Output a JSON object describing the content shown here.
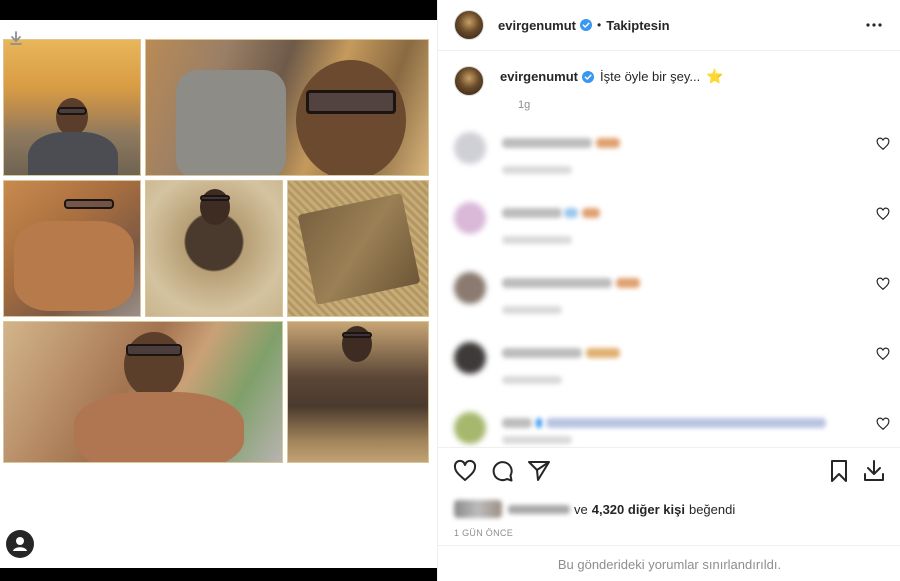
{
  "post": {
    "username": "evirgenumut",
    "follow_status": "Takiptesin",
    "separator": "•",
    "caption_text": "İşte öyle bir şey...",
    "caption_time": "1g",
    "likes_connector": "ve",
    "likes_count_text": "4,320 diğer kişi",
    "likes_suffix": "beğendi",
    "post_time": "1 GÜN ÖNCE",
    "comments_restricted": "Bu gönderideki yorumlar sınırlandırıldı."
  },
  "icons": {
    "header_more": "more-horizontal-icon",
    "verified": "verified-badge-icon",
    "caption_emoji": "star-icon",
    "like": "heart-icon",
    "comment": "comment-bubble-icon",
    "share": "paper-plane-icon",
    "save": "bookmark-icon",
    "download": "download-icon",
    "tagged_people": "profile-tag-icon"
  },
  "colors": {
    "verified_blue": "#3897f0",
    "text_primary": "#262626",
    "text_secondary": "#8e8e8e",
    "divider": "#efefef",
    "star_yellow": "#d1a20a"
  }
}
